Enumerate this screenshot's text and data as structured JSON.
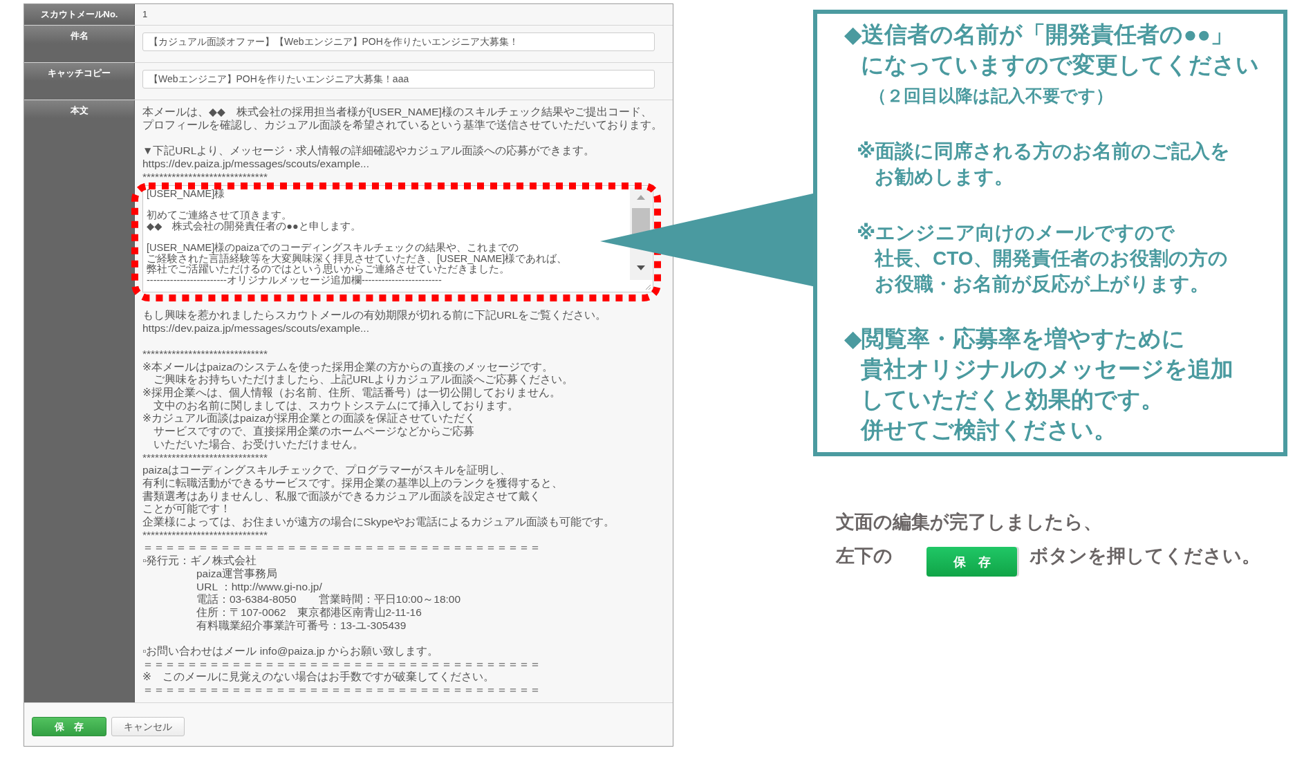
{
  "form": {
    "fields": [
      {
        "kind": "static",
        "label": "スカウトメールNo.",
        "value": "1"
      },
      {
        "kind": "input",
        "label": "件名",
        "value": "【カジュアル面談オファー】【Webエンジニア】POHを作りたいエンジニア大募集！"
      },
      {
        "kind": "input",
        "label": "キャッチコピー",
        "value": "【Webエンジニア】POHを作りたいエンジニア大募集！aaa"
      }
    ],
    "body": {
      "label": "本文",
      "before": [
        [
          "本メールは、◆◆　株式会社の採用担当者様が[USER_NAME]様のスキルチェック結果やご提出コード、",
          "プロフィールを確認し、カジュアル面談を希望されているという基準で送信させていただいております。"
        ],
        [
          "▼下記URLより、メッセージ・求人情報の詳細確認やカジュアル面談への応募ができます。",
          "https://dev.paiza.jp/messages/scouts/example...",
          "******************************"
        ]
      ],
      "editor": [
        [
          "[USER_NAME]様"
        ],
        [
          "初めてご連絡させて頂きます。",
          "◆◆　株式会社の開発責任者の●●と申します。"
        ],
        [
          "[USER_NAME]様のpaizaでのコーディングスキルチェックの結果や、これまでの",
          "ご経験された言語経験等を大変興味深く拝見させていただき、[USER_NAME]様であれば、",
          "弊社でご活躍いただけるのではという思いからご連絡させていただきました。",
          "------------------------オリジナルメッセージ追加欄------------------------"
        ]
      ],
      "after": [
        [
          "もし興味を惹かれましたらスカウトメールの有効期限が切れる前に下記URLをご覧ください。",
          "https://dev.paiza.jp/messages/scouts/example..."
        ],
        [
          "******************************",
          "※本メールはpaizaのシステムを使った採用企業の方からの直接のメッセージです。",
          "　ご興味をお持ちいただけましたら、上記URLよりカジュアル面談へご応募ください。",
          "※採用企業へは、個人情報（お名前、住所、電話番号）は一切公開しておりません。",
          "　文中のお名前に関しましては、スカウトシステムにて挿入しております。",
          "※カジュアル面談はpaizaが採用企業との面談を保証させていただく",
          "　サービスですので、直接採用企業のホームページなどからご応募",
          "　いただいた場合、お受けいただけません。",
          "******************************",
          "paizaはコーディングスキルチェックで、プログラマーがスキルを証明し、",
          "有利に転職活動ができるサービスです。採用企業の基準以上のランクを獲得すると、",
          "書類選考はありませんし、私服で面談ができるカジュアル面談を設定させて戴く",
          "ことが可能です！",
          "企業様によっては、お住まいが遠方の場合にSkypeやお電話によるカジュアル面談も可能です。",
          "******************************",
          "＝＝＝＝＝＝＝＝＝＝＝＝＝＝＝＝＝＝＝＝＝＝＝＝＝＝＝＝＝＝＝＝＝＝＝＝",
          {
            "text": "▫発行元：ギノ株式会社",
            "children": [
              "paiza運営事務局",
              "URL ：http://www.gi-no.jp/",
              "電話：03-6384-8050　　営業時間：平日10:00～18:00",
              "住所：〒107-0062　東京都港区南青山2-11-16",
              "有料職業紹介事業許可番号：13-ユ-305439"
            ]
          }
        ],
        [
          "▫お問い合わせはメール info@paiza.jp からお願い致します。",
          "＝＝＝＝＝＝＝＝＝＝＝＝＝＝＝＝＝＝＝＝＝＝＝＝＝＝＝＝＝＝＝＝＝＝＝＝",
          "※　このメールに見覚えのない場合はお手数ですが破棄してください。",
          "＝＝＝＝＝＝＝＝＝＝＝＝＝＝＝＝＝＝＝＝＝＝＝＝＝＝＝＝＝＝＝＝＝＝＝＝"
        ]
      ]
    },
    "buttons": [
      {
        "kind": "primary",
        "label": "保　存"
      },
      {
        "kind": "secondary",
        "label": "キャンセル"
      }
    ]
  },
  "callout": {
    "blocks": [
      {
        "kind": "heading",
        "lines": [
          "◆送信者の名前が「開発責任者の●●」",
          "になっていますので変更してください"
        ]
      },
      {
        "kind": "sub",
        "lines": [
          "（２回目以降は記入不要です）"
        ]
      },
      {
        "kind": "note",
        "lines": [
          "※面談に同席される方のお名前のご記入を",
          "お勧めします。"
        ]
      },
      {
        "kind": "note",
        "lines": [
          "※エンジニア向けのメールですので",
          "社長、CTO、開発責任者のお役割の方の",
          "お役職・お名前が反応が上がります。"
        ]
      },
      {
        "kind": "heading",
        "lines": [
          "◆閲覧率・応募率を増やすために",
          "貴社オリジナルのメッセージを追加",
          "していただくと効果的です。",
          "併せてご検討ください。"
        ]
      }
    ]
  },
  "instruction": {
    "line": "文面の編集が完了しましたら、",
    "before_button": "左下の",
    "button": "保　存",
    "after_button": "ボタンを押してください。"
  }
}
